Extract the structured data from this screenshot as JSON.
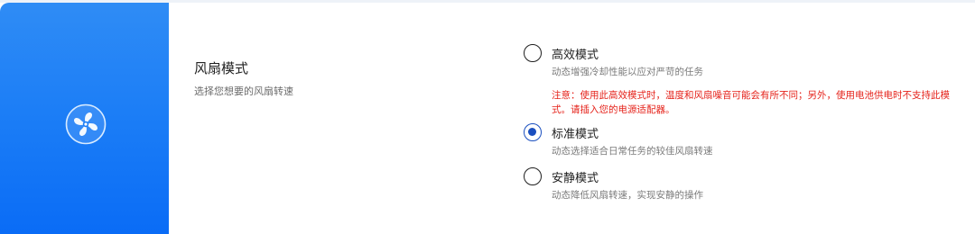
{
  "section": {
    "title": "风扇模式",
    "description": "选择您想要的风扇转速",
    "icon": "fan-icon"
  },
  "options": [
    {
      "label": "高效模式",
      "description": "动态增强冷却性能以应对严苛的任务",
      "warning": "注意：使用此高效模式时，温度和风扇噪音可能会有所不同；另外，使用电池供电时不支持此模式。请插入您的电源适配器。",
      "selected": false
    },
    {
      "label": "标准模式",
      "description": "动态选择适合日常任务的较佳风扇转速",
      "selected": true
    },
    {
      "label": "安静模式",
      "description": "动态降低风扇转速，实现安静的操作",
      "selected": false
    }
  ],
  "colors": {
    "panel_gradient_top": "#2f8cf5",
    "panel_gradient_bottom": "#0a6cf6",
    "accent": "#1a4fbf",
    "warning": "#e5231b"
  }
}
